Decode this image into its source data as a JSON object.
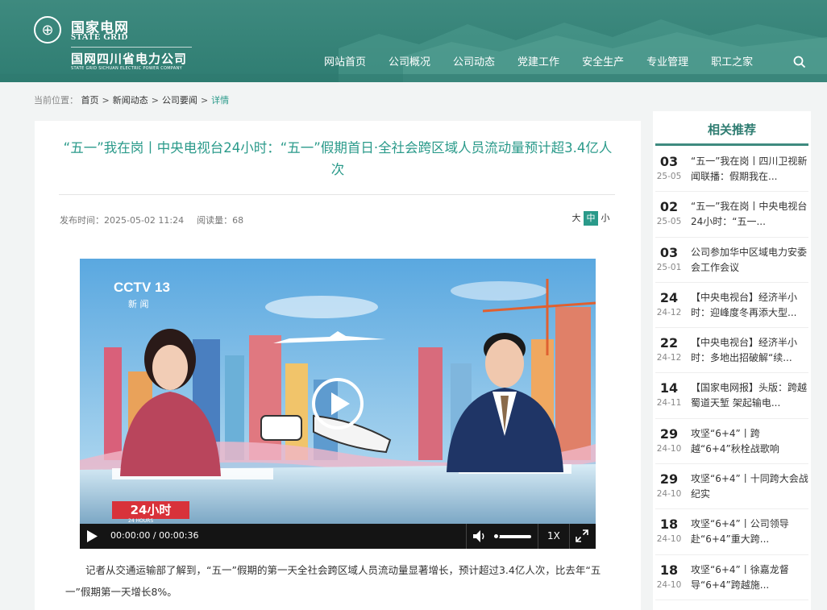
{
  "header": {
    "logo_cn": "国家电网",
    "logo_en": "STATE GRID",
    "logo_sub": "国网四川省电力公司",
    "logo_sub_en": "STATE GRID SICHUAN ELECTRIC POWER COMPANY",
    "nav": [
      "网站首页",
      "公司概况",
      "公司动态",
      "党建工作",
      "安全生产",
      "专业管理",
      "职工之家"
    ]
  },
  "breadcrumb": {
    "label": "当前位置：",
    "items": [
      "首页",
      "新闻动态",
      "公司要闻"
    ],
    "current": "详情"
  },
  "article": {
    "title": "“五一”我在岗丨中央电视台24小时：“五一”假期首日·全社会跨区域人员流动量预计超3.4亿人次",
    "publish": "发布时间：2025-05-02 11:24",
    "views": "阅读量：68",
    "font_sizes": [
      "大",
      "中",
      "小"
    ],
    "font_size_selected": "中",
    "body": "记者从交通运输部了解到，“五一”假期的第一天全社会跨区域人员流动量显著增长，预计超过3.4亿人次，比去年“五一”假期第一天增长8%。"
  },
  "video": {
    "channel_logo": "CCTV 13",
    "channel_sub": "新 闻",
    "program_logo": "24小时",
    "program_sub": "24 HOURS",
    "time": "00:00:00 / 00:00:36",
    "speed": "1X",
    "volume_level": 0.05
  },
  "sidebar": {
    "title": "相关推荐",
    "items": [
      {
        "day": "03",
        "ym": "25-05",
        "text": "“五一”我在岗丨四川卫视新闻联播：假期我在..."
      },
      {
        "day": "02",
        "ym": "25-05",
        "text": "“五一”我在岗丨中央电视台24小时：“五一..."
      },
      {
        "day": "03",
        "ym": "25-01",
        "text": "公司参加华中区域电力安委会工作会议"
      },
      {
        "day": "24",
        "ym": "24-12",
        "text": "【中央电视台】经济半小时：迎峰度冬再添大型..."
      },
      {
        "day": "22",
        "ym": "24-12",
        "text": "【中央电视台】经济半小时：多地出招破解“续..."
      },
      {
        "day": "14",
        "ym": "24-11",
        "text": "【国家电网报】头版：跨越蜀道天堑 架起输电..."
      },
      {
        "day": "29",
        "ym": "24-10",
        "text": "攻坚“6+4”丨跨越“6+4”秋栓战歌响"
      },
      {
        "day": "29",
        "ym": "24-10",
        "text": "攻坚“6+4”丨十同跨大会战纪实"
      },
      {
        "day": "18",
        "ym": "24-10",
        "text": "攻坚“6+4”丨公司领导赴“6+4”重大跨..."
      },
      {
        "day": "18",
        "ym": "24-10",
        "text": "攻坚“6+4”丨徐嘉龙督导“6+4”跨越施..."
      }
    ]
  },
  "colors": {
    "header_bg": "#3e8a7f",
    "accent": "#2a9a8a",
    "page_bg": "#f2f4f4"
  }
}
